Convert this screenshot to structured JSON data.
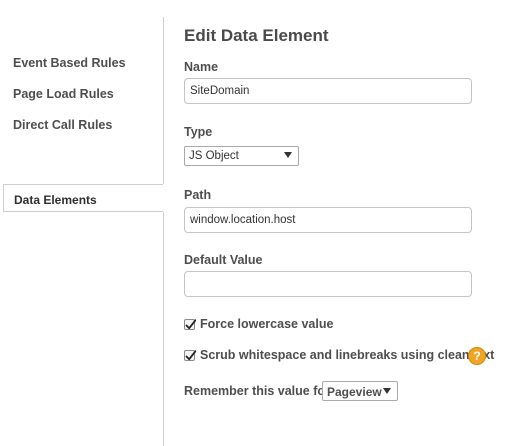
{
  "sidebar": {
    "items": [
      {
        "label": "Event Based Rules"
      },
      {
        "label": "Page Load Rules"
      },
      {
        "label": "Direct Call Rules"
      }
    ],
    "active_tab": {
      "label": "Data Elements"
    }
  },
  "form": {
    "title": "Edit Data Element",
    "name": {
      "label": "Name",
      "value": "SiteDomain"
    },
    "type": {
      "label": "Type",
      "selected": "JS Object"
    },
    "path": {
      "label": "Path",
      "value": "window.location.host"
    },
    "default_value": {
      "label": "Default Value",
      "value": ""
    },
    "force_lowercase": {
      "label": "Force lowercase value",
      "checked": true
    },
    "scrub_whitespace": {
      "label": "Scrub whitespace and linebreaks using cleanText",
      "checked": true,
      "help_icon": "?"
    },
    "remember": {
      "label": "Remember this value for",
      "selected": "Pageview"
    }
  },
  "colors": {
    "help_icon": "#f2a524",
    "divider": "#cfcfcf",
    "text": "#4e4e4e"
  },
  "icons": {
    "checkbox_check": "check-icon",
    "help": "question-mark-icon",
    "dropdown": "chevron-down-icon"
  }
}
